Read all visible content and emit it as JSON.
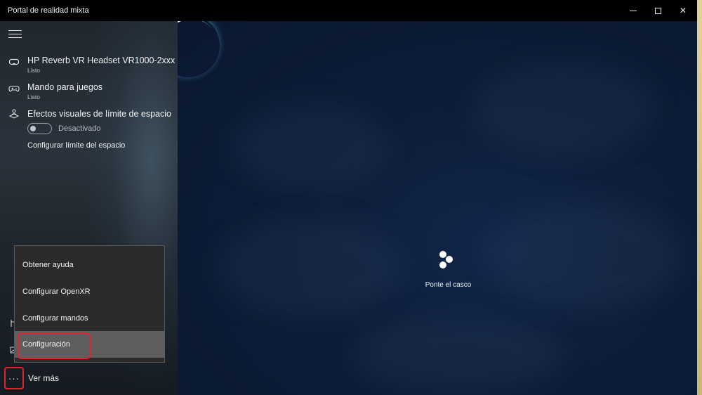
{
  "window": {
    "title": "Portal de realidad mixta",
    "minimize_icon": "minimize-icon",
    "maximize_icon": "maximize-icon",
    "close_glyph": "✕"
  },
  "sidebar": {
    "devices": [
      {
        "icon": "headset-icon",
        "title": "HP Reverb VR Headset VR1000-2xxx",
        "status": "Listo"
      },
      {
        "icon": "gamepad-icon",
        "title": "Mando para juegos",
        "status": "Listo"
      }
    ],
    "boundary": {
      "icon": "boundary-icon",
      "title": "Efectos visuales de límite de espacio",
      "toggle_label": "Desactivado",
      "toggle_on": false,
      "configure_link": "Configurar límite del espacio"
    },
    "more": {
      "glyph": "···",
      "label": "Ver más"
    }
  },
  "menu": {
    "items": [
      {
        "label": "Obtener ayuda",
        "selected": false
      },
      {
        "label": "Configurar OpenXR",
        "selected": false
      },
      {
        "label": "Configurar mandos",
        "selected": false
      },
      {
        "label": "Configuración",
        "selected": true
      }
    ]
  },
  "main": {
    "status_icon": "headset-loading-icon",
    "status_text": "Ponte el casco"
  },
  "colors": {
    "highlight": "#e0222c",
    "background": "#0e1c33",
    "accent_streak": "#7fd4ff"
  }
}
